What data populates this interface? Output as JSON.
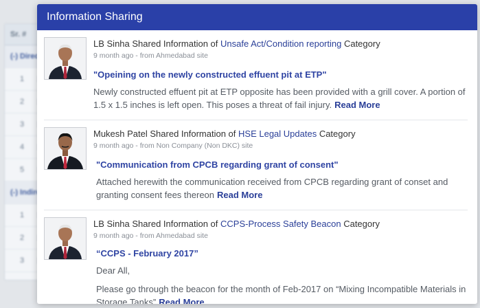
{
  "background_table": {
    "header": "Sr. #",
    "groups": [
      {
        "label": "(-) Direct",
        "rows": [
          "1",
          "2",
          "3",
          "4",
          "5"
        ]
      },
      {
        "label": "(-) Indirect",
        "rows": [
          "1",
          "2",
          "3"
        ]
      }
    ]
  },
  "panel": {
    "title": "Information Sharing",
    "items": [
      {
        "author": "LB Sinha",
        "shared_text": " Shared Information of ",
        "category": "Unsafe Act/Condition reporting",
        "category_suffix": " Category",
        "meta": "9 month ago - from Ahmedabad site",
        "title": "\"Opeining on the newly constructed effuent pit at ETP\"",
        "description": "Newly constructed effuent pit at ETP opposite has been provided with a grill cover. A portion of 1.5 x 1.5 inches is left open. This poses a threat of fail injury.",
        "read_more": "Read More"
      },
      {
        "author": "Mukesh Patel",
        "shared_text": " Shared Information of ",
        "category": "HSE Legal Updates",
        "category_suffix": " Category",
        "meta": "9 month ago - from Non Company (Non DKC)  site",
        "title": "\"Communication from CPCB regarding grant of consent\"",
        "description": "Attached herewith the communication received from CPCB regarding grant of conset and granting consent fees thereon",
        "read_more": "Read More"
      },
      {
        "author": "LB Sinha",
        "shared_text": " Shared Information of ",
        "category": "CCPS-Process Safety Beacon",
        "category_suffix": " Category",
        "meta": "9 month ago - from Ahmedabad site",
        "title": "“CCPS - February 2017”",
        "greeting": "Dear All,",
        "description": "Please go through the beacon for the month of Feb-2017 on “Mixing Incompatible Materials in Storage Tanks”",
        "read_more": "Read More"
      }
    ]
  }
}
